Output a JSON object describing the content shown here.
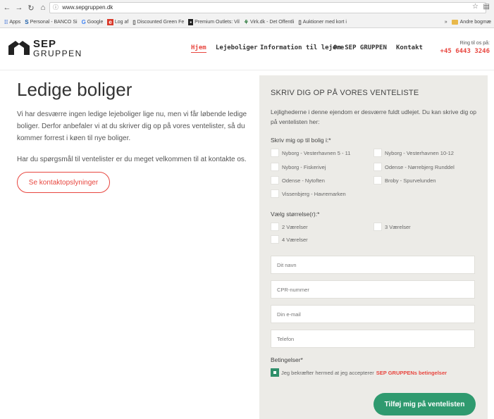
{
  "browser": {
    "url": "www.sepgruppen.dk",
    "bookmarks": [
      "Apps",
      "Personal - BANCO Si",
      "Google",
      "Log af",
      "Discounted Green Fe",
      "Premium Outlets: Vil",
      "Virk.dk - Det Offentli",
      "Auktioner med kort i"
    ],
    "bookmarks_more": "»",
    "other_bookmarks": "Andre bogmæ"
  },
  "header": {
    "logo_line1": "SEP",
    "logo_line2": "GRUPPEN",
    "nav": [
      "Hjem",
      "Lejeboliger",
      "Information til lejere",
      "Om SEP GRUPPEN",
      "Kontakt"
    ],
    "call_label": "Ring til os på:",
    "phone": "+45 6443 3246"
  },
  "main": {
    "title": "Ledige boliger",
    "intro": "Vi har desværre ingen ledige lejeboliger lige nu, men vi får løbende ledige boliger. Derfor anbefaler vi at du skriver dig op på vores ventelister, så du kommer forrest i køen til nye boliger.",
    "intro2": "Har du spørgsmål til ventelister er du meget velkommen til at kontakte os.",
    "contact_button": "Se kontaktopslyninger"
  },
  "form": {
    "title": "SKRIV DIG OP PÅ VORES VENTELISTE",
    "description": "Lejlighederne i denne ejendom er desværre fuldt udlejet. Du kan skrive dig op på ventelisten her:",
    "housing_label": "Skriv mig op til bolig i:*",
    "housing_options": [
      "Nyborg - Vesterhavnen 5 - 11",
      "Nyborg - Vesterhavnen 10-12",
      "Nyborg - Fiskerivej",
      "Odense - Nørrebjerg Runddel",
      "Odense - Nytoften",
      "Broby - Spurvelunden",
      "Vissenbjerg - Havremarken"
    ],
    "size_label": "Vælg størrelse(r):*",
    "size_options": [
      "2 Værelser",
      "3 Værelser",
      "4 Værelser"
    ],
    "name_placeholder": "Dit navn",
    "cpr_placeholder": "CPR-nummer",
    "email_placeholder": "Din e-mail",
    "phone_placeholder": "Telefon",
    "terms_label": "Betingelser*",
    "terms_text": "Jeg bekræfter hermed at jeg accepterer",
    "terms_link": "SEP GRUPPENs betingelser",
    "submit": "Tilføj mig på ventelisten"
  },
  "colors": {
    "accent_red": "#e8463f",
    "submit_green": "#2f9a6f",
    "panel_bg": "#ecebe7"
  }
}
